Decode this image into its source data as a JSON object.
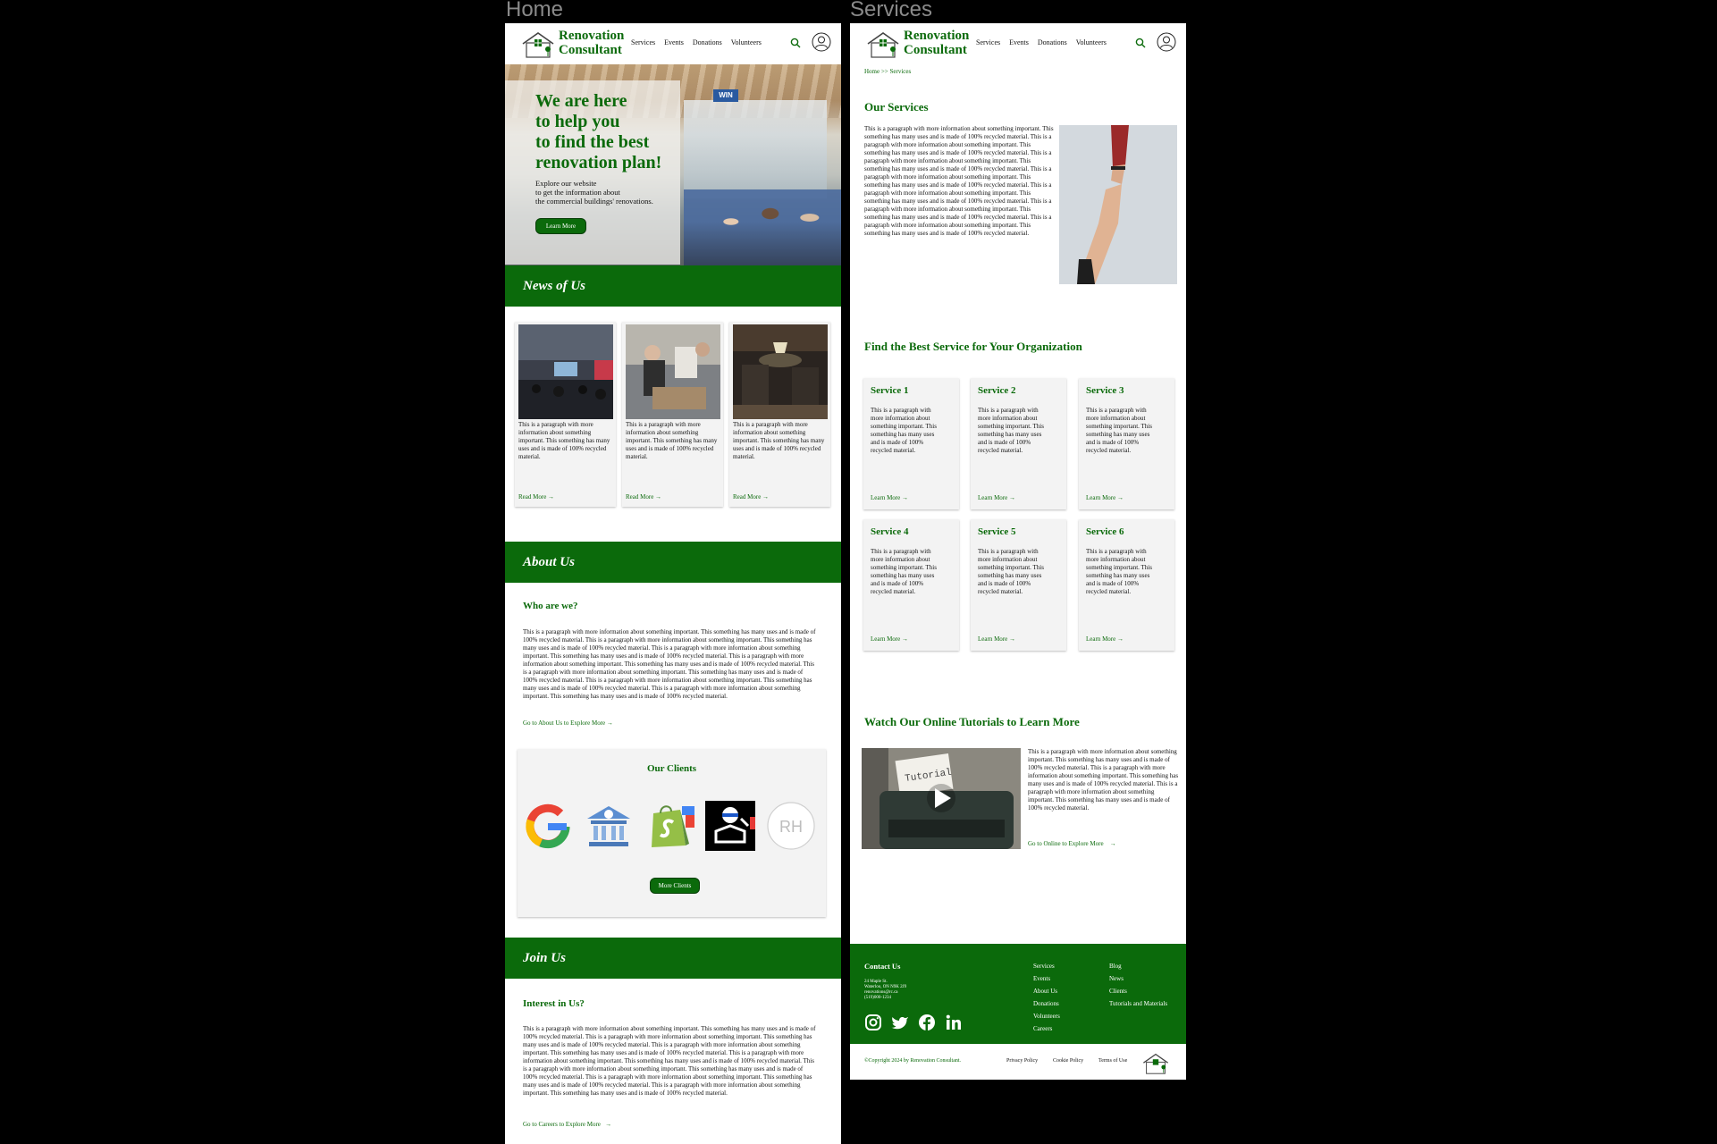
{
  "frames": {
    "home_label": "Home",
    "services_label": "Services"
  },
  "brand": {
    "line1": "Renovation",
    "line2": "Consultant",
    "color": "#0b6a0b"
  },
  "nav": {
    "items": [
      "Services",
      "Events",
      "Donations",
      "Volunteers"
    ]
  },
  "home": {
    "hero": {
      "title_lines": [
        "We are here",
        "to help you",
        "to find the best",
        "renovation plan!"
      ],
      "sub_lines": [
        "Explore our website",
        "to get the information about",
        "the commercial buildings' renovations."
      ],
      "button": "Learn More",
      "sign": "WIN"
    },
    "news": {
      "heading": "News of Us",
      "cards": [
        {
          "text": "This is a paragraph with more information about something important. This something has many uses and is made of 100% recycled material.",
          "link": "Read More"
        },
        {
          "text": "This is a paragraph with more information about something important. This something has many uses and is made of 100% recycled material.",
          "link": "Read More"
        },
        {
          "text": "This is a paragraph with more information about something important. This something has many uses and is made of 100% recycled material.",
          "link": "Read More"
        }
      ]
    },
    "about": {
      "heading": "About Us",
      "sub": "Who are we?",
      "para": "This is a paragraph with more information about something important. This something has many uses and is made of 100% recycled material. This is a paragraph with more information about something important. This something has many uses and is made of 100% recycled material. This is a paragraph with more information about something important. This something has many uses and is made of 100% recycled material. This is a paragraph with more information about something important. This something has many uses and is made of 100% recycled material. This is a paragraph with more information about something important. This something has many uses and is made of 100% recycled material. This is a paragraph with more information about something important. This something has many uses and is made of 100% recycled material. This is a paragraph with more information about something important. This something has many uses and is made of 100% recycled material.",
      "link": "Go to About Us to Explore More",
      "clients_title": "Our Clients",
      "clients_button": "More Clients",
      "client_mark": "RH"
    },
    "join": {
      "heading": "Join Us",
      "sub": "Interest in Us?",
      "para": "This is a paragraph with more information about something important. This something has many uses and is made of 100% recycled material. This is a paragraph with more information about something important. This something has many uses and is made of 100% recycled material. This is a paragraph with more information about something important. This something has many uses and is made of 100% recycled material. This is a paragraph with more information about something important. This something has many uses and is made of 100% recycled material. This is a paragraph with more information about something important. This something has many uses and is made of 100% recycled material. This is a paragraph with more information about something important. This something has many uses and is made of 100% recycled material. This is a paragraph with more information about something important. This something has many uses and is made of 100% recycled material.",
      "link": "Go to Careers to Explore More"
    }
  },
  "services": {
    "breadcrumb": "Home >> Services",
    "our_services": "Our Services",
    "our_services_para": "This is a paragraph with more information about something important. This something has many uses and is made of 100% recycled material. This is a paragraph with more information about something important. This something has many uses and is made of 100% recycled material. This is a paragraph with more information about something important. This something has many uses and is made of 100% recycled material. This is a paragraph with more information about something important. This something has many uses and is made of 100% recycled material. This is a paragraph with more information about something important. This something has many uses and is made of 100% recycled material. This is a paragraph with more information about something important. This something has many uses and is made of 100% recycled material. This is a paragraph with more information about something important. This something has many uses and is made of 100% recycled material.",
    "find_best": "Find the Best Service for Your Organization",
    "cards": [
      {
        "title": "Service 1",
        "text": "This is a paragraph with more information about something important. This something has many uses and is made of 100% recycled material.",
        "link": "Learn More"
      },
      {
        "title": "Service 2",
        "text": "This is a paragraph with more information about something important. This something has many uses and is made of 100% recycled material.",
        "link": "Learn More"
      },
      {
        "title": "Service 3",
        "text": "This is a paragraph with more information about something important. This something has many uses and is made of 100% recycled material.",
        "link": "Learn More"
      },
      {
        "title": "Service 4",
        "text": "This is a paragraph with more information about something important. This something has many uses and is made of 100% recycled material.",
        "link": "Learn More"
      },
      {
        "title": "Service 5",
        "text": "This is a paragraph with more information about something important. This something has many uses and is made of 100% recycled material.",
        "link": "Learn More"
      },
      {
        "title": "Service 6",
        "text": "This is a paragraph with more information about something important. This something has many uses and is made of 100% recycled material.",
        "link": "Learn More"
      }
    ],
    "tutorials": "Watch Our Online Tutorials to Learn More",
    "tutorials_para": "This is a paragraph with more information about something important. This something has many uses and is made of 100% recycled material. This is a paragraph with more information about something important. This something has many uses and is made of 100% recycled material. This is a paragraph with more information about something important. This something has many uses and is made of 100% recycled material.",
    "tutorials_link": "Go to Online to Explore More",
    "tutorial_img_text": "Tutorial"
  },
  "footer": {
    "contact": "Contact Us",
    "addr_lines": [
      "24 Maple St.",
      "Waterloo, ON N9K 2J9",
      "renovations@rc.ca",
      "(519)000-1234"
    ],
    "col1": [
      "Services",
      "Events",
      "About Us",
      "Donations",
      "Volunteers",
      "Careers"
    ],
    "col2": [
      "Blog",
      "News",
      "Clients",
      "Tutorials and Materials"
    ],
    "copyright": "©Copyright 2024 by Renovation Consultant.",
    "legal": [
      "Privacy Policy",
      "Cookie Policy",
      "Terms of Use"
    ]
  }
}
